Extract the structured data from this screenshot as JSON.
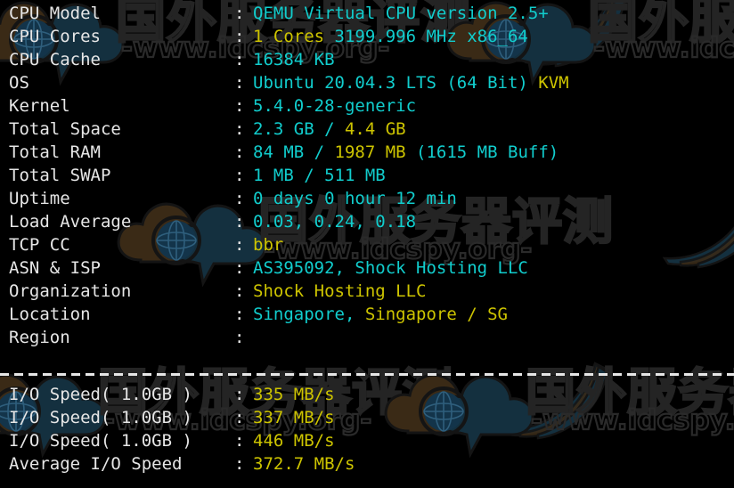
{
  "terminal": {
    "title": "VPS Benchmark Output",
    "background_color": "#000000",
    "label_color": "#E6E6E6",
    "value_cyan": "#11CDCD",
    "value_yellow": "#CDC400",
    "separator": "dashed-line"
  },
  "info": {
    "rows": [
      {
        "label": "CPU Model",
        "colon": ":",
        "segments": [
          {
            "text": "QEMU Virtual CPU version 2.5+",
            "color": "cyan"
          }
        ]
      },
      {
        "label": "CPU Cores",
        "colon": ":",
        "segments": [
          {
            "text": "1 Cores",
            "color": "yellow"
          },
          {
            "text": " 3199.996 MHz x86_64",
            "color": "cyan"
          }
        ]
      },
      {
        "label": "CPU Cache",
        "colon": ":",
        "segments": [
          {
            "text": "16384 KB",
            "color": "cyan"
          }
        ]
      },
      {
        "label": "OS",
        "colon": ":",
        "segments": [
          {
            "text": "Ubuntu 20.04.3 LTS (64 Bit) ",
            "color": "cyan"
          },
          {
            "text": "KVM",
            "color": "yellow"
          }
        ]
      },
      {
        "label": "Kernel",
        "colon": ":",
        "segments": [
          {
            "text": "5.4.0-28-generic",
            "color": "cyan"
          }
        ]
      },
      {
        "label": "Total Space",
        "colon": ":",
        "segments": [
          {
            "text": "2.3 GB ",
            "color": "cyan"
          },
          {
            "text": "/",
            "color": "cyan"
          },
          {
            "text": " 4.4 GB",
            "color": "yellow"
          }
        ]
      },
      {
        "label": "Total RAM",
        "colon": ":",
        "segments": [
          {
            "text": "84 MB ",
            "color": "cyan"
          },
          {
            "text": "/",
            "color": "cyan"
          },
          {
            "text": " 1987 MB",
            "color": "yellow"
          },
          {
            "text": " (1615 MB Buff)",
            "color": "cyan"
          }
        ]
      },
      {
        "label": "Total SWAP",
        "colon": ":",
        "segments": [
          {
            "text": "1 MB / 511 MB",
            "color": "cyan"
          }
        ]
      },
      {
        "label": "Uptime",
        "colon": ":",
        "segments": [
          {
            "text": "0 days 0 hour 12 min",
            "color": "cyan"
          }
        ]
      },
      {
        "label": "Load Average",
        "colon": ":",
        "segments": [
          {
            "text": "0.03, 0.24, 0.18",
            "color": "cyan"
          }
        ]
      },
      {
        "label": "TCP CC",
        "colon": ":",
        "segments": [
          {
            "text": "bbr",
            "color": "yellow"
          }
        ]
      },
      {
        "label": "ASN & ISP",
        "colon": ":",
        "segments": [
          {
            "text": "AS395092, Shock Hosting LLC",
            "color": "cyan"
          }
        ]
      },
      {
        "label": "Organization",
        "colon": ":",
        "segments": [
          {
            "text": "Shock Hosting LLC",
            "color": "yellow"
          }
        ]
      },
      {
        "label": "Location",
        "colon": ":",
        "segments": [
          {
            "text": "Singapore, ",
            "color": "cyan"
          },
          {
            "text": "Singapore / SG",
            "color": "yellow"
          }
        ]
      },
      {
        "label": "Region",
        "colon": ":",
        "segments": []
      }
    ]
  },
  "io": {
    "rows": [
      {
        "label": "I/O Speed( 1.0GB )",
        "colon": ":",
        "value": "335 MB/s"
      },
      {
        "label": "I/O Speed( 1.0GB )",
        "colon": ":",
        "value": "337 MB/s"
      },
      {
        "label": "I/O Speed( 1.0GB )",
        "colon": ":",
        "value": "446 MB/s"
      },
      {
        "label": "Average I/O Speed",
        "colon": ":",
        "value": "372.7 MB/s"
      }
    ]
  },
  "watermarks": [
    {
      "cn_text": "国外服务器评测",
      "url_text": "-www.idcspy.org-"
    },
    {
      "cn_text": "国外服务器评测",
      "url_text": "-www.idcspy.org-"
    },
    {
      "cn_text": "国外服务器评测",
      "url_text": "-www.idcspy.org-"
    },
    {
      "cn_text": "国外服务器评测",
      "url_text": "-www.idcspy.org-"
    }
  ]
}
